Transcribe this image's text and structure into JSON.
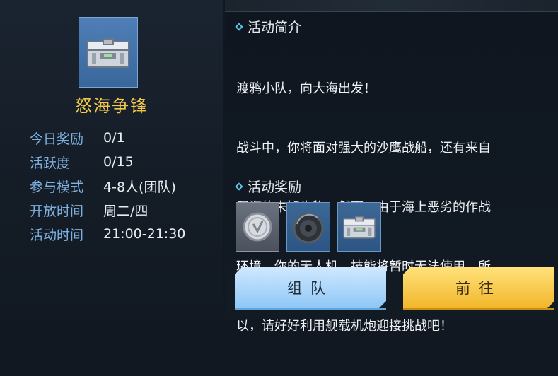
{
  "event": {
    "title": "怒海争锋",
    "icon": "supply-crate-icon"
  },
  "info": [
    {
      "label": "今日奖励",
      "value": "0/1"
    },
    {
      "label": "活跃度",
      "value": "0/15"
    },
    {
      "label": "参与模式",
      "value": "4-8人(团队)"
    },
    {
      "label": "开放时间",
      "value": "周二/四"
    },
    {
      "label": "活动时间",
      "value": "21:00-21:30"
    }
  ],
  "intro": {
    "heading": "活动简介",
    "lines": [
      "渡鸦小队，向大海出发！",
      "战斗中，你将面对强大的沙鹰战船，还有来自",
      "深海的未知生物。然而，由于海上恶劣的作战",
      "环境，你的无人机、技能将暂时无法使用。所",
      "以，请好好利用舰载机炮迎接挑战吧！"
    ]
  },
  "rewards": {
    "heading": "活动奖励",
    "items": [
      "silver-coin-icon",
      "gear-disc-icon",
      "supply-crate-icon"
    ]
  },
  "buttons": {
    "team": "组队",
    "go": "前往"
  },
  "colors": {
    "title_gold": "#f2c84b",
    "label_blue": "#7fb2e2",
    "accent_cyan": "#58c6e8",
    "team_button": "#a8d6fa",
    "go_button": "#f7c640"
  }
}
